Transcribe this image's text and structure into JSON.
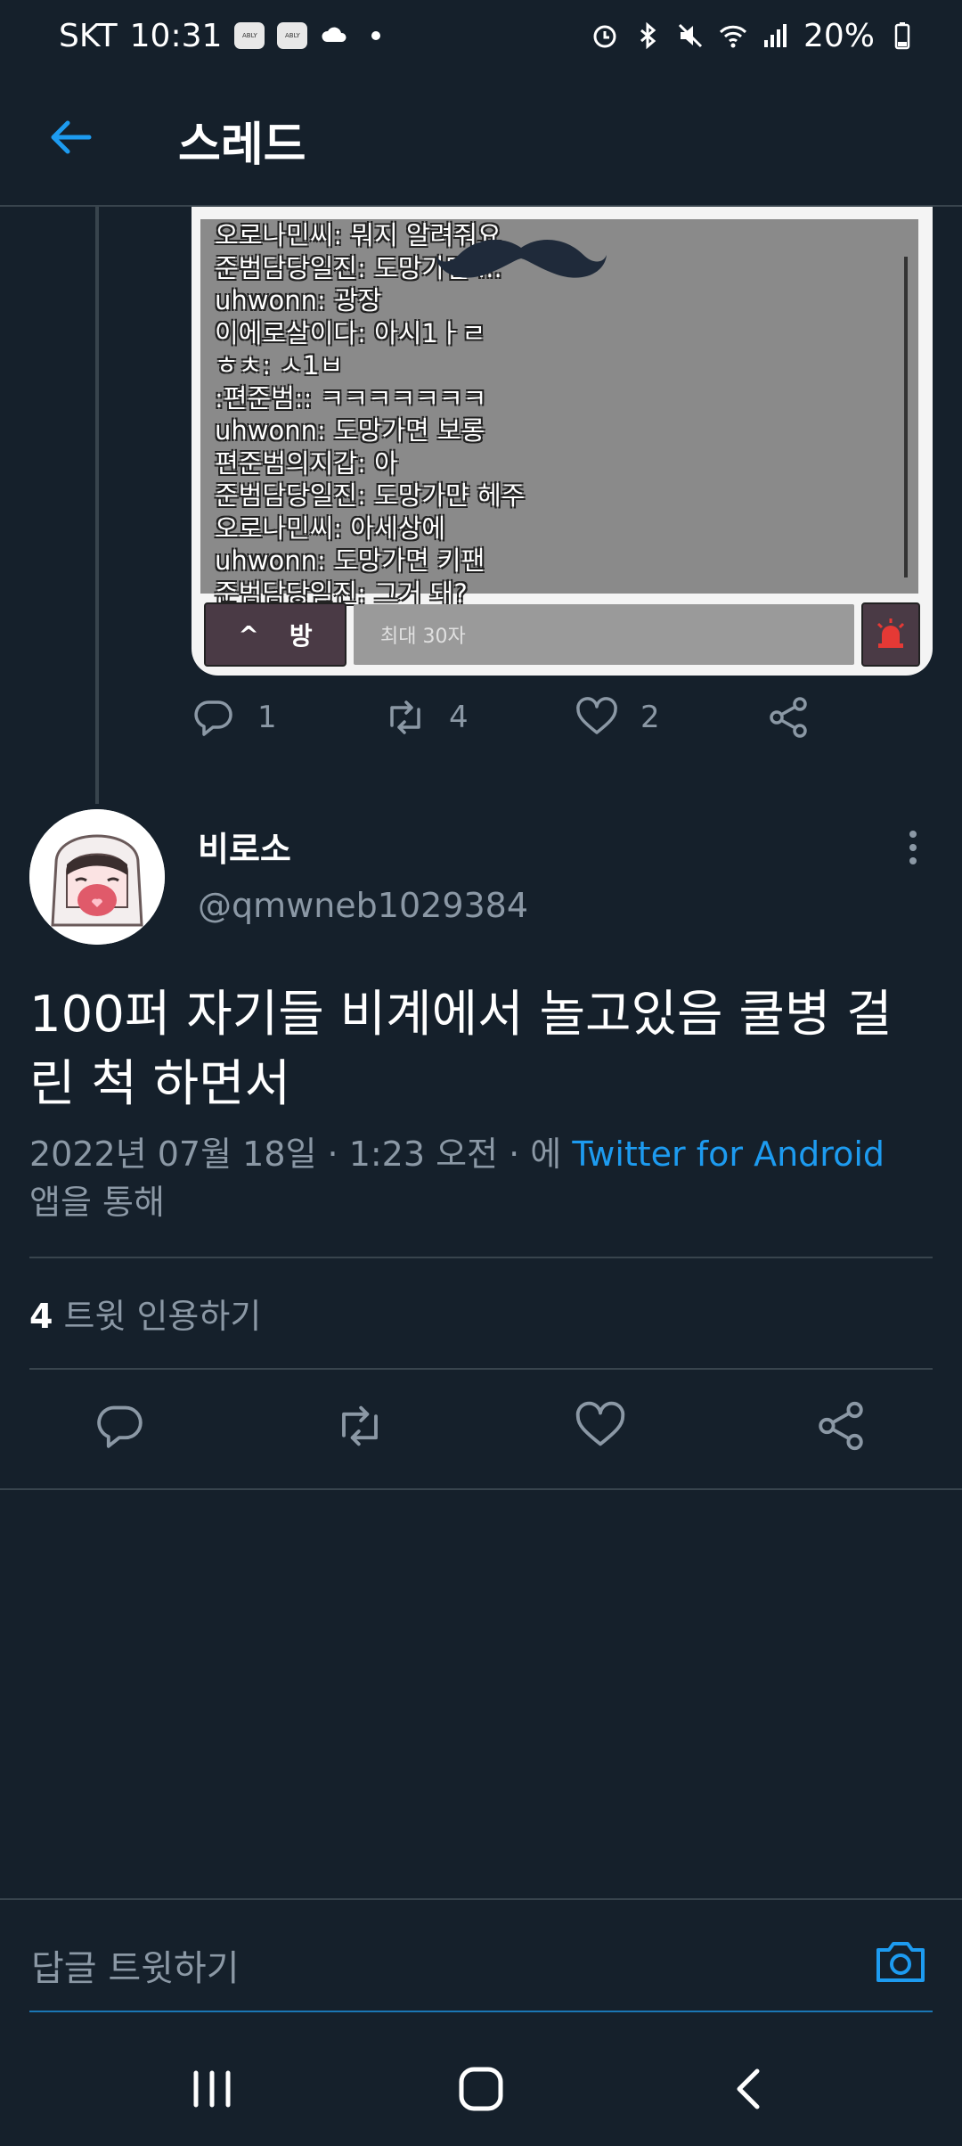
{
  "status_bar": {
    "carrier": "SKT",
    "time": "10:31",
    "badge1": "ABLY",
    "badge2": "ABLY",
    "battery": "20%"
  },
  "header": {
    "title": "스레드"
  },
  "media": {
    "chat_lines": [
      "오로나민씨: 뭐지 알려줘요",
      "준범담당일진: 도망가면 ...",
      "uhwonn: 광장",
      "이에로살이다: 아시1ㅏㄹ",
      "ㅎㅊ: ㅅ1ㅂ",
      ":편준범:: ㅋㅋㅋㅋㅋㅋㅋ",
      "uhwonn: 도망가면 보롱",
      "편준범의지갑: 아",
      "준범담당일진: 도망가먄 헤주",
      "오로나민씨: 아세상에",
      "uhwonn: 도망가면 키팬",
      "준범담당일진: 그거 돼?"
    ],
    "room_button": "방",
    "room_button_arrow": "^",
    "input_placeholder": "최대 30자"
  },
  "prev_tweet_actions": {
    "reply_count": "1",
    "retweet_count": "4",
    "like_count": "2"
  },
  "tweet": {
    "display_name": "비로소",
    "handle": "@qmwneb1029384",
    "text": "100퍼 자기들 비계에서 놀고있음 쿨병 걸린 척 하면서",
    "timestamp": "2022년 07월 18일 · 1:23 오전 · 에 ",
    "source": "Twitter for Android",
    "source_suffix": "앱을 통해",
    "quote_count": "4",
    "quote_label": "트윗 인용하기"
  },
  "reply_bar": {
    "placeholder": "답글 트윗하기"
  },
  "colors": {
    "background": "#15202b",
    "accent": "#1d9bf0",
    "muted": "#8b98a5",
    "divider": "#38444d"
  }
}
